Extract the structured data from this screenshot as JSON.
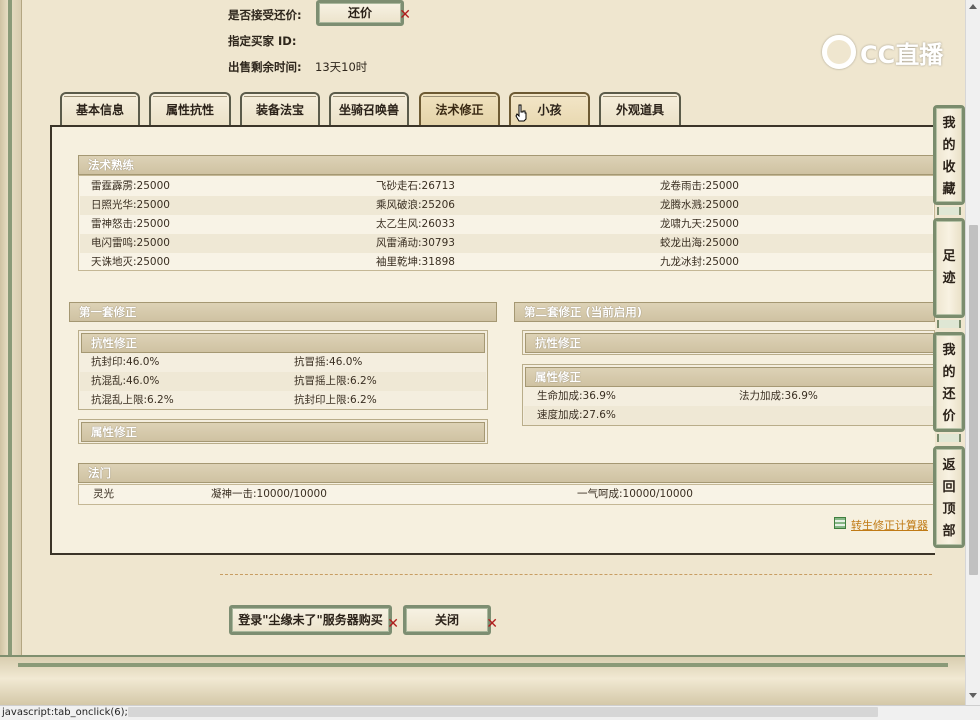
{
  "header": {
    "accept_counter_label": "是否接受还价:",
    "counter_button": "还价",
    "buyer_id_label": "指定买家 ID:",
    "time_left_label": "出售剩余时间:",
    "time_left_value": "13天10时"
  },
  "logo": {
    "text": "CC直播"
  },
  "tabs": [
    {
      "label": "基本信息"
    },
    {
      "label": "属性抗性"
    },
    {
      "label": "装备法宝"
    },
    {
      "label": "坐骑召唤兽"
    },
    {
      "label": "法术修正"
    },
    {
      "label": "小孩"
    },
    {
      "label": "外观道具"
    }
  ],
  "spell_mastery": {
    "title": "法术熟练",
    "rows": [
      [
        "雷霆霹雳:25000",
        "飞砂走石:26713",
        "龙卷雨击:25000"
      ],
      [
        "日照光华:25000",
        "乘风破浪:25206",
        "龙腾水溅:25000"
      ],
      [
        "雷神怒击:25000",
        "太乙生风:26033",
        "龙啸九天:25000"
      ],
      [
        "电闪雷鸣:25000",
        "风雷涌动:30793",
        "蛟龙出海:25000"
      ],
      [
        "天诛地灭:25000",
        "袖里乾坤:31898",
        "九龙冰封:25000"
      ]
    ]
  },
  "set1": {
    "title": "第一套修正",
    "resist_title": "抗性修正",
    "resist_rows": [
      [
        "抗封印:46.0%",
        "抗冒摇:46.0%"
      ],
      [
        "抗混乱:46.0%",
        "抗冒摇上限:6.2%"
      ],
      [
        "抗混乱上限:6.2%",
        "抗封印上限:6.2%"
      ]
    ],
    "attr_title": "属性修正"
  },
  "set2": {
    "title": "第二套修正 (当前启用)",
    "resist_title": "抗性修正",
    "attr_title": "属性修正",
    "attr_rows": [
      [
        "生命加成:36.9%",
        "法力加成:36.9%"
      ],
      [
        "速度加成:27.6%",
        ""
      ]
    ]
  },
  "fa_men": {
    "title": "法门",
    "row": [
      "灵光",
      "凝神一击:10000/10000",
      "一气呵成:10000/10000"
    ]
  },
  "calc_link": "转生修正计算器",
  "bottom_buttons": {
    "buy": "登录\"尘缘未了\"服务器购买",
    "close": "关闭"
  },
  "side_buttons": [
    {
      "label": "我的收藏",
      "chars": [
        "我",
        "的",
        "收",
        "藏"
      ]
    },
    {
      "label": "足迹",
      "chars": [
        "足",
        "迹"
      ]
    },
    {
      "label": "我的还价",
      "chars": [
        "我",
        "的",
        "还",
        "价"
      ]
    },
    {
      "label": "返回顶部",
      "chars": [
        "返",
        "回",
        "顶",
        "部"
      ]
    }
  ],
  "status_bar": "javascript:tab_onclick(6);"
}
